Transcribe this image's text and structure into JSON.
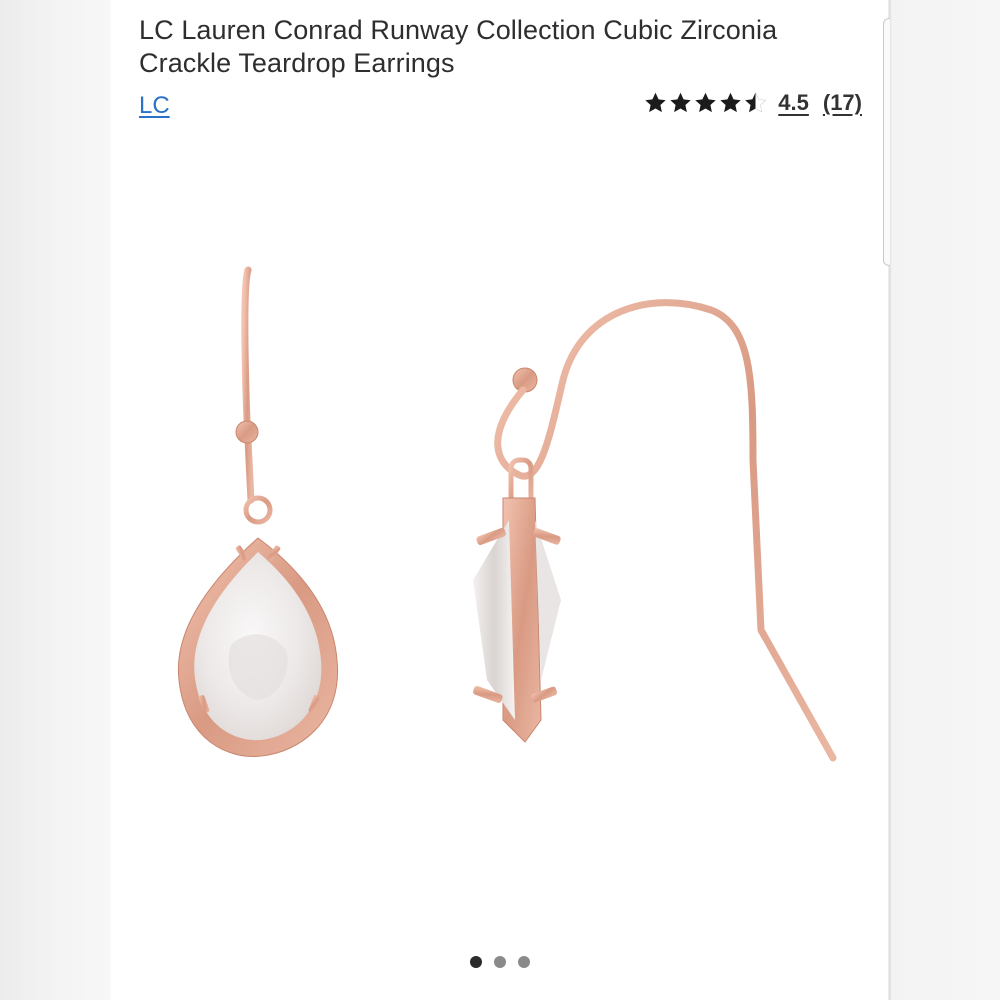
{
  "product": {
    "title": "LC Lauren Conrad Runway Collection Cubic Zirconia Crackle Teardrop Earrings",
    "brand_link": "LC",
    "rating": {
      "stars": 4.5,
      "max_stars": 5,
      "value_text": "4.5",
      "count_text": "(17)"
    },
    "image_subject": "rose-gold teardrop earrings",
    "carousel": {
      "total": 3,
      "active_index": 0
    }
  },
  "colors": {
    "title": "#2e2e2e",
    "link": "#2a72c9",
    "rose_gold": "#e3a58f",
    "stone": "#eeeae8"
  }
}
